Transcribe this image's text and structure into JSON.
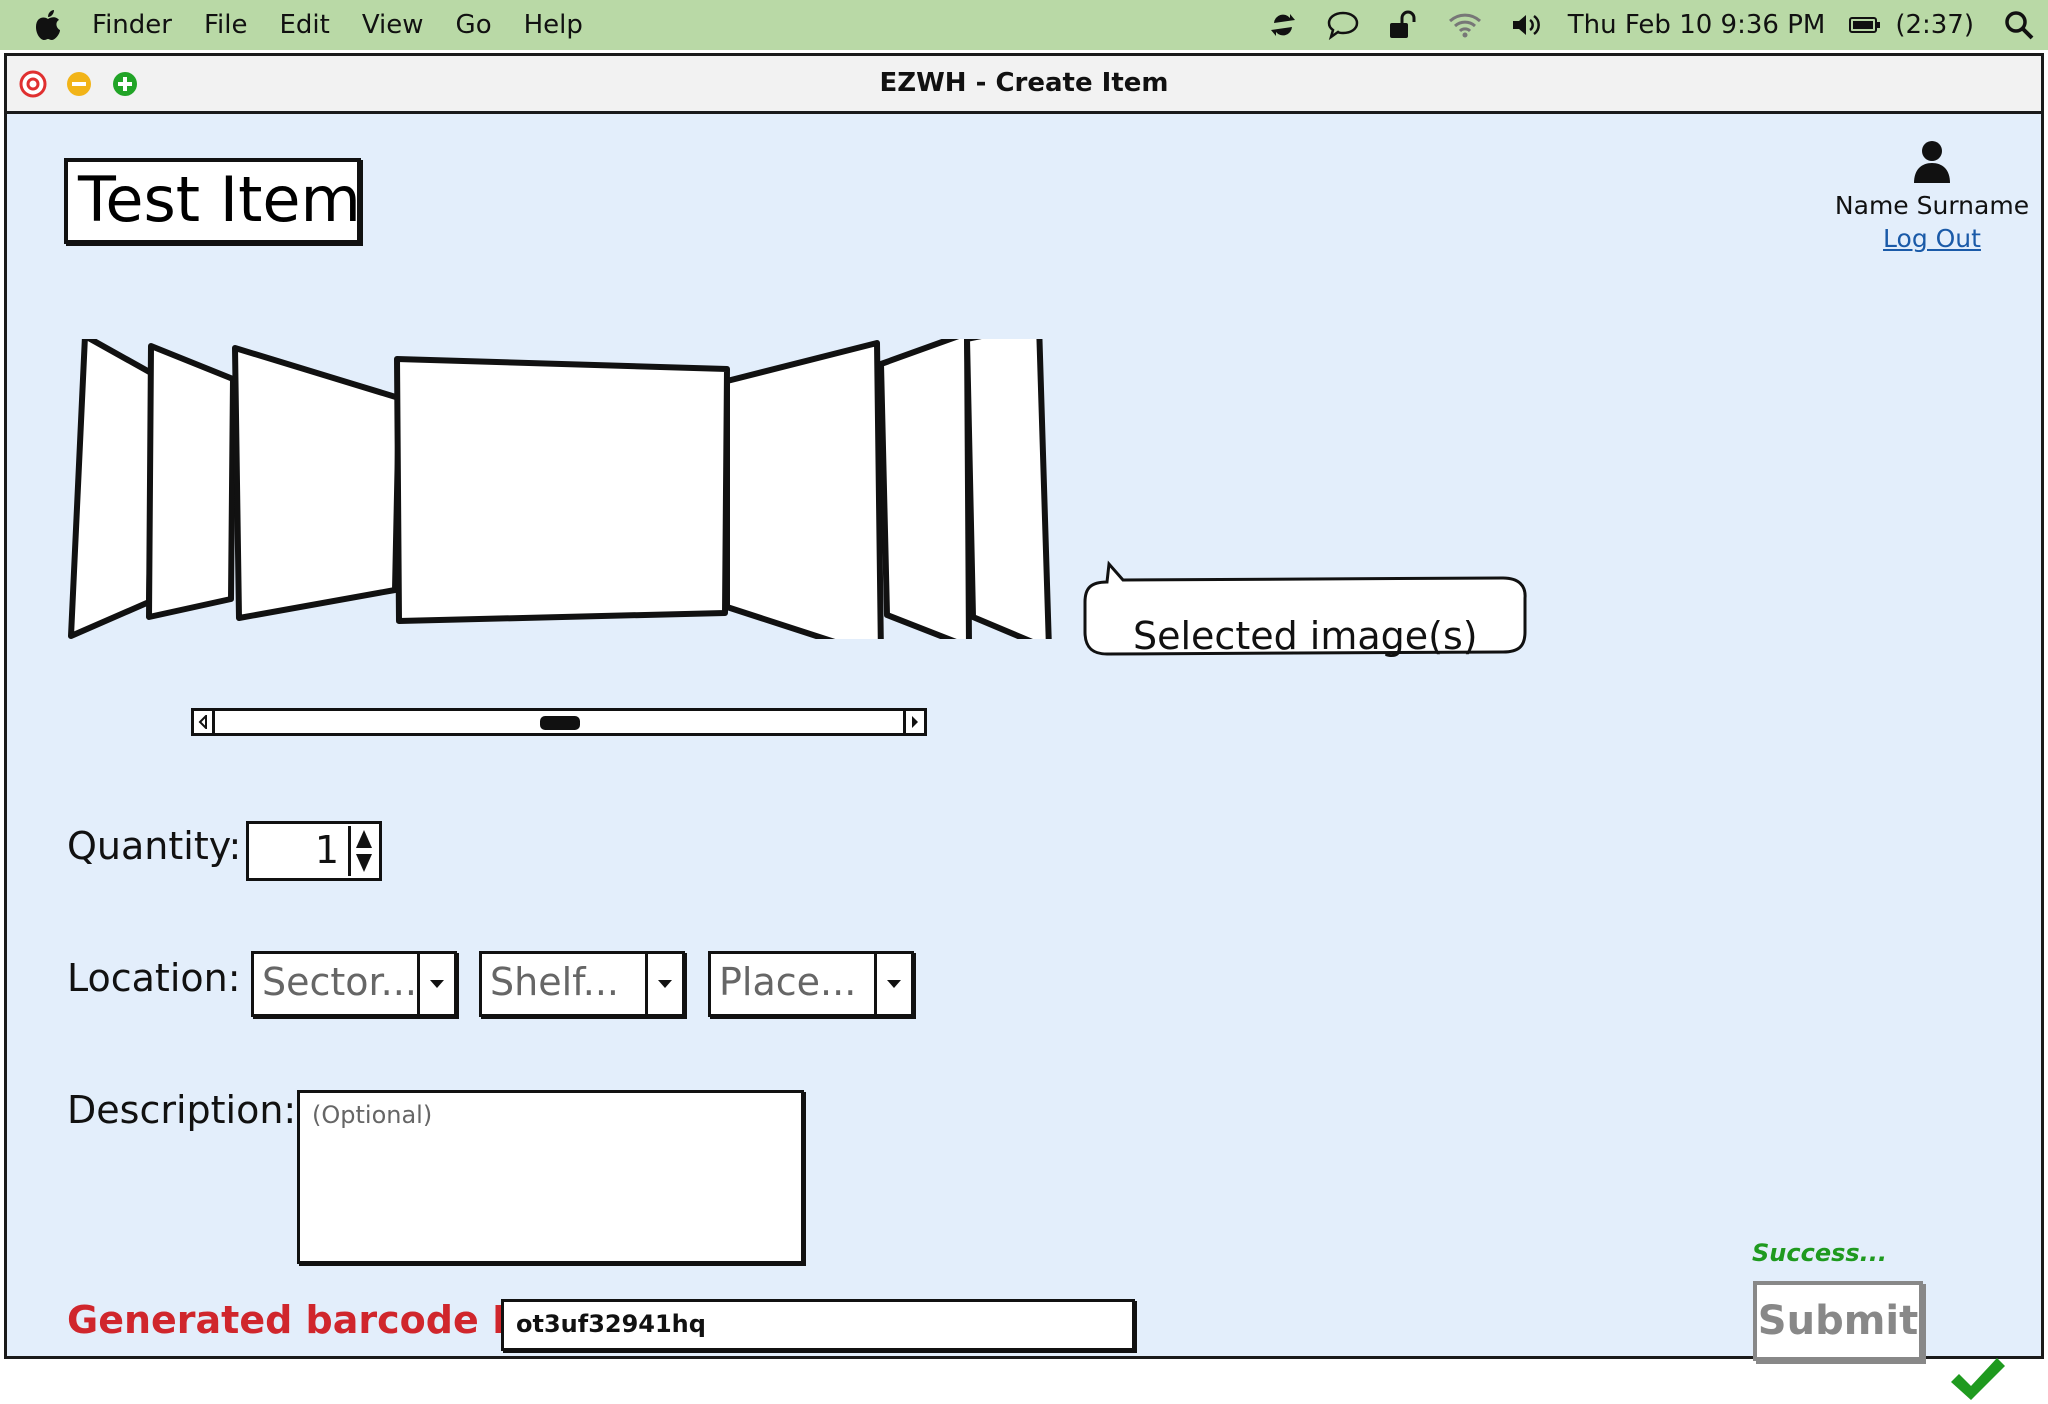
{
  "menubar": {
    "items": [
      "Finder",
      "File",
      "Edit",
      "View",
      "Go",
      "Help"
    ],
    "datetime": "Thu Feb 10  9:36 PM",
    "battery": "(2:37)"
  },
  "window": {
    "title": "EZWH - Create Item"
  },
  "item": {
    "title": "Test Item"
  },
  "user": {
    "name": "Name Surname",
    "logout": "Log Out"
  },
  "carousel": {
    "callout": "Selected image(s)"
  },
  "quantity": {
    "label": "Quantity:",
    "value": "1"
  },
  "location": {
    "label": "Location:",
    "sector": "Sector...",
    "shelf": "Shelf...",
    "place": "Place..."
  },
  "description": {
    "label": "Description:",
    "placeholder": "(Optional)"
  },
  "barcode": {
    "label": "Generated barcode ID:",
    "value": "ot3uf32941hq"
  },
  "submit": {
    "status": "Success...",
    "label": "Submit"
  },
  "colors": {
    "menubar": "#b9d9a6",
    "window_bg": "#e3eefb",
    "barcode_label": "#d0262c",
    "success": "#1f9a1f",
    "link": "#1a5aa8"
  }
}
